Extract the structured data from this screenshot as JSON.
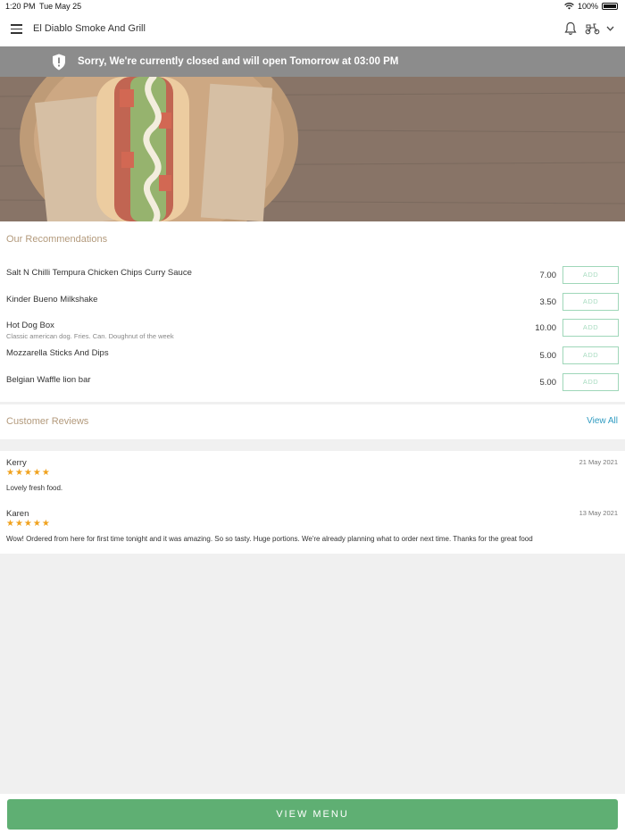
{
  "status": {
    "time": "1:20 PM",
    "date": "Tue May 25",
    "battery": "100%"
  },
  "header": {
    "title": "El Diablo Smoke And Grill"
  },
  "banner": {
    "message": "Sorry, We're currently closed and will open Tomorrow at 03:00 PM"
  },
  "recommendations": {
    "title": "Our Recommendations",
    "add_label": "ADD",
    "items": [
      {
        "name": "Salt N Chilli Tempura Chicken Chips Curry Sauce",
        "desc": "",
        "price": "7.00"
      },
      {
        "name": "Kinder Bueno Milkshake",
        "desc": "",
        "price": "3.50"
      },
      {
        "name": "Hot Dog Box",
        "desc": "Classic american dog. Fries. Can. Doughnut of the week",
        "price": "10.00"
      },
      {
        "name": "Mozzarella Sticks And Dips",
        "desc": "",
        "price": "5.00"
      },
      {
        "name": "Belgian Waffle lion bar",
        "desc": "",
        "price": "5.00"
      }
    ]
  },
  "reviews": {
    "title": "Customer Reviews",
    "view_all": "View All",
    "items": [
      {
        "name": "Kerry",
        "date": "21 May 2021",
        "rating": 5,
        "stars": "★★★★★",
        "text": "Lovely fresh food."
      },
      {
        "name": "Karen",
        "date": "13 May 2021",
        "rating": 5,
        "stars": "★★★★★",
        "text": "Wow! Ordered from here for first time tonight and it was amazing. So so tasty. Huge portions. We're already planning what to order next time. Thanks for the great food"
      }
    ]
  },
  "footer": {
    "view_menu": "VIEW MENU"
  },
  "colors": {
    "accent_green": "#5faf73",
    "section_title": "#b39a7c",
    "link_blue": "#2f9bc1",
    "star_orange": "#f0a21e",
    "banner_gray": "#8c8c8c"
  },
  "icons": {
    "menu": "hamburger-icon",
    "notifications": "bell-icon",
    "delivery": "scooter-icon",
    "dropdown": "chevron-down-icon",
    "alert": "shield-alert-icon"
  }
}
